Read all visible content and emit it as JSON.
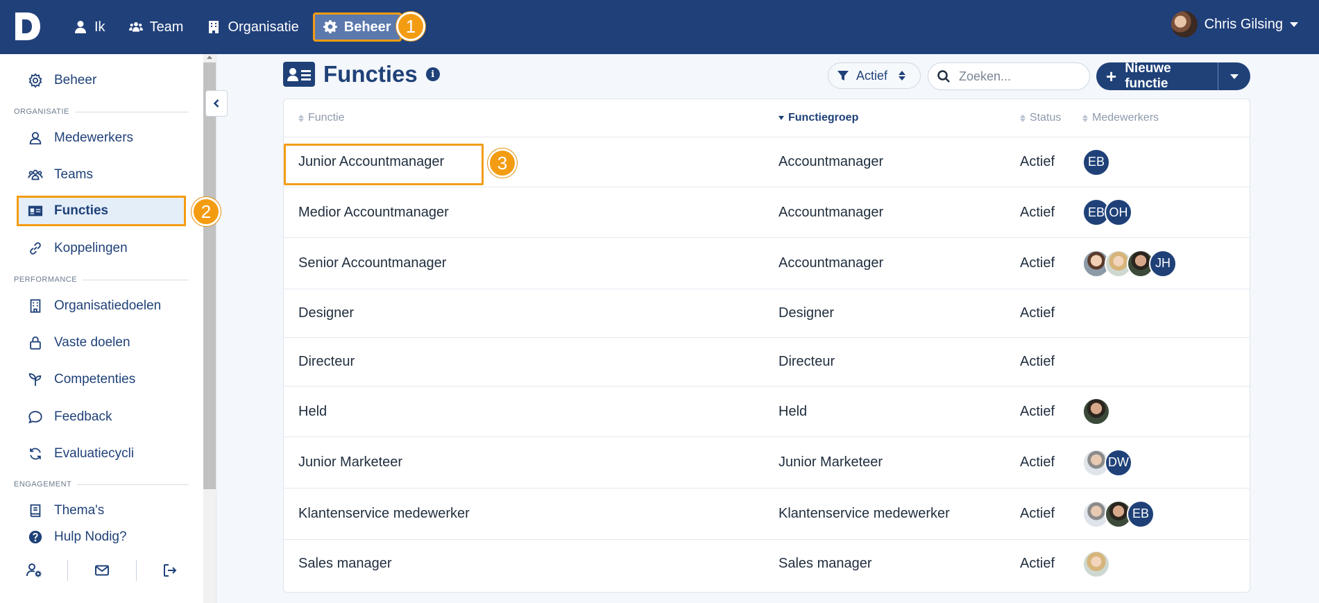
{
  "topbar": {
    "logo_letter": "D",
    "nav": [
      {
        "label": "Ik",
        "icon": "user-icon"
      },
      {
        "label": "Team",
        "icon": "users-icon"
      },
      {
        "label": "Organisatie",
        "icon": "building-icon"
      },
      {
        "label": "Beheer",
        "icon": "gear-icon",
        "active": true
      }
    ],
    "user_name": "Chris Gilsing"
  },
  "markers": {
    "one": "1",
    "two": "2",
    "three": "3"
  },
  "sidebar": {
    "items": [
      {
        "label": "Beheer",
        "icon": "gear-icon"
      },
      {
        "label": "Medewerkers",
        "icon": "user-icon"
      },
      {
        "label": "Teams",
        "icon": "users-icon"
      },
      {
        "label": "Functies",
        "icon": "id-card-icon",
        "active": true
      },
      {
        "label": "Koppelingen",
        "icon": "link-icon"
      },
      {
        "label": "Organisatiedoelen",
        "icon": "building-icon"
      },
      {
        "label": "Vaste doelen",
        "icon": "lock-icon"
      },
      {
        "label": "Competenties",
        "icon": "sprout-icon"
      },
      {
        "label": "Feedback",
        "icon": "chat-icon"
      },
      {
        "label": "Evaluatiecycli",
        "icon": "refresh-icon"
      },
      {
        "label": "Thema's",
        "icon": "book-icon"
      },
      {
        "label": "Hulp Nodig?",
        "icon": "question-icon"
      }
    ],
    "sections": {
      "organisatie": "ORGANISATIE",
      "performance": "PERFORMANCE",
      "engagement": "ENGAGEMENT"
    }
  },
  "header": {
    "title": "Functies",
    "filter_label": "Actief",
    "search_placeholder": "Zoeken...",
    "new_button": "Nieuwe functie"
  },
  "table": {
    "columns": {
      "functie": "Functie",
      "functiegroep": "Functiegroep",
      "status": "Status",
      "medewerkers": "Medewerkers"
    },
    "rows": [
      {
        "functie": "Junior Accountmanager",
        "functiegroep": "Accountmanager",
        "status": "Actief",
        "avatars": [
          {
            "type": "init",
            "text": "EB"
          }
        ]
      },
      {
        "functie": "Medior Accountmanager",
        "functiegroep": "Accountmanager",
        "status": "Actief",
        "avatars": [
          {
            "type": "init",
            "text": "EB"
          },
          {
            "type": "init",
            "text": "OH"
          }
        ]
      },
      {
        "functie": "Senior Accountmanager",
        "functiegroep": "Accountmanager",
        "status": "Actief",
        "avatars": [
          {
            "type": "photo",
            "style": "photo"
          },
          {
            "type": "photo",
            "style": "blond"
          },
          {
            "type": "photo",
            "style": "dark"
          },
          {
            "type": "init",
            "text": "JH"
          }
        ]
      },
      {
        "functie": "Designer",
        "functiegroep": "Designer",
        "status": "Actief",
        "avatars": []
      },
      {
        "functie": "Directeur",
        "functiegroep": "Directeur",
        "status": "Actief",
        "avatars": []
      },
      {
        "functie": "Held",
        "functiegroep": "Held",
        "status": "Actief",
        "avatars": [
          {
            "type": "photo",
            "style": "dark"
          }
        ]
      },
      {
        "functie": "Junior Marketeer",
        "functiegroep": "Junior Marketeer",
        "status": "Actief",
        "avatars": [
          {
            "type": "photo",
            "style": "grey"
          },
          {
            "type": "init",
            "text": "DW"
          }
        ]
      },
      {
        "functie": "Klantenservice medewerker",
        "functiegroep": "Klantenservice medewerker",
        "status": "Actief",
        "avatars": [
          {
            "type": "photo",
            "style": "grey"
          },
          {
            "type": "photo",
            "style": "dark"
          },
          {
            "type": "init",
            "text": "EB"
          }
        ]
      },
      {
        "functie": "Sales manager",
        "functiegroep": "Sales manager",
        "status": "Actief",
        "avatars": [
          {
            "type": "photo",
            "style": "blond"
          }
        ]
      }
    ]
  },
  "colors": {
    "primary": "#1f4178",
    "topbar": "#20407a",
    "accent": "#f39c12",
    "active_bg": "#e4eef9"
  }
}
